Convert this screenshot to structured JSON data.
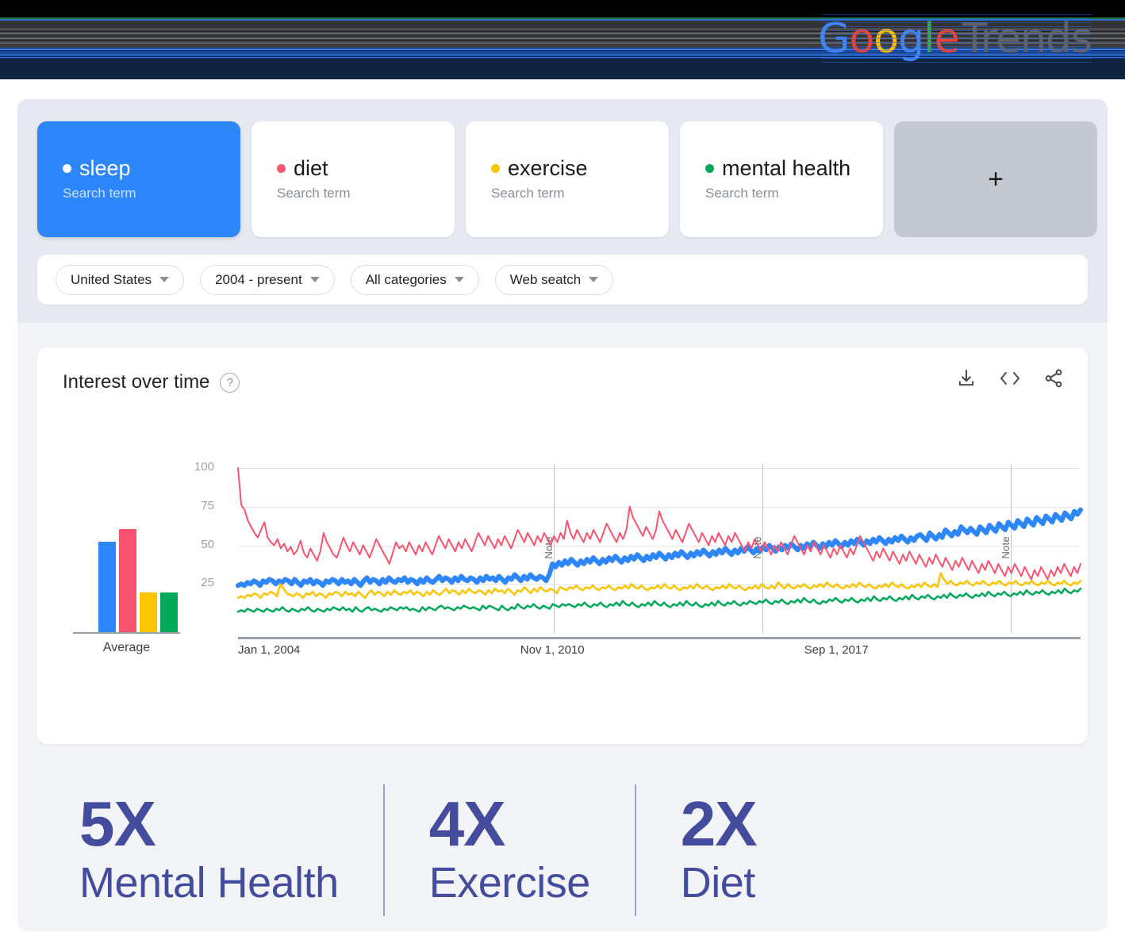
{
  "brand": {
    "logo_letters": [
      "G",
      "o",
      "o",
      "g",
      "l",
      "e"
    ],
    "logo_suffix": "Trends"
  },
  "search_terms": [
    {
      "term": "sleep",
      "type_label": "Search term",
      "color": "#ffffff",
      "active": true
    },
    {
      "term": "diet",
      "type_label": "Search term",
      "color": "#f9546f",
      "active": false
    },
    {
      "term": "exercise",
      "type_label": "Search term",
      "color": "#fdc500",
      "active": false
    },
    {
      "term": "mental health",
      "type_label": "Search term",
      "color": "#00a859",
      "active": false
    }
  ],
  "add_term_button": "+",
  "filters": [
    {
      "label": "United States"
    },
    {
      "label": "2004 - present"
    },
    {
      "label": "All categories"
    },
    {
      "label": "Web seatch"
    }
  ],
  "chart_card": {
    "title": "Interest over time",
    "help_icon": "?",
    "tools": [
      {
        "name": "download-icon"
      },
      {
        "name": "embed-code-icon"
      },
      {
        "name": "share-icon"
      }
    ]
  },
  "stats": [
    {
      "multiplier": "5X",
      "label": "Mental Health"
    },
    {
      "multiplier": "4X",
      "label": "Exercise"
    },
    {
      "multiplier": "2X",
      "label": "Diet"
    }
  ],
  "chart_data": {
    "type": "line",
    "title": "Interest over time",
    "xlabel": "",
    "ylabel": "",
    "ylim": [
      0,
      100
    ],
    "yticks": [
      100,
      75,
      50,
      25
    ],
    "xticks": [
      "Jan 1, 2004",
      "Nov 1, 2010",
      "Sep 1, 2017"
    ],
    "grid": true,
    "legend_position": "top-chips",
    "annotations": [
      {
        "text": "Note",
        "x_fraction": 0.375
      },
      {
        "text": "Note",
        "x_fraction": 0.622
      },
      {
        "text": "Note",
        "x_fraction": 0.917
      }
    ],
    "average_bar_chart": {
      "type": "bar",
      "label": "Average",
      "categories": [
        "sleep",
        "diet",
        "exercise",
        "mental health"
      ],
      "values": [
        43,
        49,
        19,
        19
      ],
      "colors": [
        "#2e86fb",
        "#f9546f",
        "#fdc500",
        "#00a859"
      ]
    },
    "series": [
      {
        "name": "sleep",
        "color": "#2e86fb",
        "width": 6,
        "values": [
          24,
          25,
          24,
          26,
          25,
          27,
          26,
          24,
          27,
          26,
          28,
          27,
          25,
          27,
          26,
          28,
          27,
          25,
          28,
          26,
          24,
          27,
          26,
          28,
          25,
          27,
          26,
          24,
          27,
          26,
          28,
          27,
          25,
          28,
          26,
          27,
          25,
          28,
          26,
          24,
          27,
          29,
          26,
          28,
          27,
          25,
          28,
          26,
          29,
          27,
          26,
          28,
          27,
          29,
          26,
          28,
          27,
          25,
          28,
          26,
          29,
          27,
          26,
          28,
          30,
          27,
          29,
          28,
          26,
          29,
          27,
          30,
          28,
          27,
          29,
          28,
          26,
          29,
          27,
          30,
          28,
          29,
          27,
          30,
          28,
          26,
          29,
          28,
          31,
          29,
          27,
          30,
          28,
          31,
          29,
          28,
          30,
          29,
          27,
          31,
          38,
          36,
          39,
          37,
          40,
          38,
          41,
          39,
          37,
          40,
          38,
          41,
          39,
          42,
          40,
          38,
          41,
          39,
          42,
          40,
          43,
          41,
          39,
          42,
          40,
          43,
          41,
          44,
          42,
          40,
          43,
          41,
          44,
          42,
          45,
          43,
          41,
          44,
          42,
          45,
          43,
          46,
          44,
          42,
          45,
          43,
          46,
          44,
          47,
          45,
          43,
          46,
          44,
          47,
          45,
          48,
          46,
          44,
          47,
          45,
          48,
          46,
          49,
          47,
          45,
          48,
          46,
          49,
          47,
          50,
          48,
          46,
          49,
          47,
          50,
          48,
          51,
          49,
          47,
          50,
          48,
          51,
          49,
          52,
          50,
          48,
          51,
          49,
          52,
          50,
          53,
          51,
          49,
          52,
          50,
          53,
          51,
          54,
          52,
          50,
          53,
          51,
          54,
          52,
          55,
          53,
          51,
          54,
          52,
          55,
          53,
          56,
          54,
          52,
          55,
          53,
          56,
          57,
          55,
          53,
          58,
          56,
          54,
          57,
          55,
          60,
          58,
          56,
          59,
          57,
          62,
          60,
          58,
          61,
          59,
          57,
          62,
          60,
          58,
          63,
          61,
          59,
          64,
          62,
          60,
          65,
          63,
          61,
          66,
          64,
          62,
          67,
          65,
          63,
          68,
          66,
          64,
          69,
          67,
          65,
          70,
          68,
          66,
          71,
          69,
          67,
          72,
          70,
          73
        ]
      },
      {
        "name": "diet",
        "color": "#f9546f",
        "width": 2,
        "values": [
          100,
          76,
          73,
          66,
          62,
          58,
          55,
          60,
          65,
          55,
          52,
          50,
          54,
          48,
          51,
          46,
          49,
          44,
          47,
          53,
          45,
          42,
          48,
          44,
          40,
          46,
          58,
          52,
          48,
          44,
          42,
          48,
          55,
          50,
          46,
          52,
          48,
          44,
          50,
          46,
          42,
          48,
          54,
          50,
          46,
          42,
          38,
          45,
          52,
          48,
          50,
          46,
          52,
          48,
          44,
          50,
          46,
          52,
          48,
          44,
          50,
          56,
          52,
          48,
          54,
          50,
          46,
          52,
          48,
          54,
          50,
          46,
          52,
          58,
          54,
          50,
          56,
          52,
          48,
          54,
          50,
          56,
          52,
          48,
          54,
          60,
          56,
          52,
          58,
          54,
          50,
          56,
          52,
          58,
          54,
          50,
          56,
          52,
          58,
          54,
          66,
          58,
          54,
          60,
          56,
          52,
          58,
          54,
          60,
          56,
          52,
          58,
          64,
          60,
          56,
          52,
          58,
          54,
          60,
          75,
          68,
          64,
          60,
          56,
          62,
          58,
          54,
          60,
          72,
          66,
          62,
          58,
          54,
          60,
          56,
          52,
          58,
          64,
          60,
          56,
          52,
          58,
          54,
          50,
          56,
          52,
          58,
          54,
          50,
          56,
          52,
          58,
          54,
          50,
          46,
          52,
          48,
          54,
          50,
          46,
          52,
          48,
          44,
          50,
          46,
          52,
          48,
          44,
          50,
          56,
          52,
          48,
          44,
          50,
          46,
          52,
          48,
          44,
          50,
          46,
          42,
          48,
          44,
          50,
          46,
          42,
          48,
          44,
          50,
          56,
          52,
          48,
          44,
          40,
          46,
          42,
          48,
          44,
          40,
          46,
          42,
          38,
          44,
          40,
          46,
          42,
          38,
          44,
          40,
          36,
          42,
          38,
          44,
          40,
          36,
          42,
          38,
          34,
          40,
          36,
          42,
          38,
          34,
          40,
          36,
          32,
          38,
          34,
          40,
          36,
          32,
          38,
          34,
          30,
          36,
          32,
          38,
          34,
          30,
          36,
          32,
          28,
          34,
          30,
          36,
          32,
          28,
          34,
          30,
          36,
          32,
          38,
          34,
          30,
          36,
          32,
          38
        ]
      },
      {
        "name": "exercise",
        "color": "#fdc500",
        "width": 2.5,
        "values": [
          16,
          17,
          16,
          18,
          17,
          19,
          18,
          16,
          19,
          18,
          20,
          19,
          17,
          25,
          22,
          19,
          18,
          17,
          19,
          18,
          16,
          19,
          18,
          20,
          17,
          19,
          18,
          16,
          19,
          18,
          20,
          19,
          17,
          20,
          18,
          19,
          17,
          20,
          18,
          16,
          19,
          21,
          18,
          20,
          19,
          17,
          20,
          18,
          21,
          19,
          18,
          20,
          19,
          21,
          18,
          20,
          19,
          17,
          20,
          18,
          21,
          19,
          18,
          20,
          22,
          19,
          21,
          20,
          18,
          21,
          19,
          22,
          20,
          19,
          21,
          20,
          18,
          21,
          19,
          22,
          20,
          21,
          19,
          22,
          20,
          18,
          21,
          20,
          23,
          21,
          19,
          22,
          20,
          23,
          21,
          20,
          22,
          21,
          19,
          23,
          22,
          21,
          23,
          22,
          24,
          22,
          21,
          23,
          22,
          24,
          22,
          21,
          23,
          22,
          24,
          22,
          21,
          23,
          22,
          24,
          22,
          25,
          23,
          22,
          24,
          22,
          21,
          23,
          22,
          24,
          22,
          25,
          23,
          22,
          24,
          22,
          21,
          23,
          22,
          24,
          22,
          25,
          23,
          22,
          24,
          22,
          21,
          23,
          22,
          24,
          22,
          25,
          23,
          22,
          24,
          22,
          21,
          23,
          22,
          24,
          22,
          25,
          23,
          22,
          24,
          22,
          26,
          24,
          22,
          25,
          23,
          22,
          24,
          23,
          25,
          23,
          22,
          24,
          23,
          25,
          23,
          26,
          24,
          23,
          25,
          23,
          22,
          24,
          23,
          25,
          23,
          26,
          24,
          23,
          25,
          23,
          22,
          24,
          23,
          25,
          23,
          26,
          24,
          23,
          25,
          23,
          22,
          24,
          23,
          25,
          23,
          26,
          24,
          23,
          25,
          23,
          32,
          28,
          25,
          27,
          25,
          24,
          26,
          25,
          27,
          25,
          24,
          26,
          25,
          27,
          25,
          24,
          26,
          25,
          27,
          25,
          24,
          26,
          25,
          27,
          25,
          24,
          26,
          25,
          27,
          25,
          24,
          26,
          25,
          27,
          25,
          24,
          26,
          25,
          27,
          25,
          24,
          26,
          25,
          27
        ]
      },
      {
        "name": "mental health",
        "color": "#00a859",
        "width": 2.5,
        "values": [
          7,
          8,
          7,
          9,
          8,
          7,
          9,
          8,
          7,
          9,
          8,
          7,
          9,
          8,
          10,
          8,
          7,
          9,
          8,
          7,
          9,
          8,
          10,
          8,
          7,
          9,
          8,
          7,
          9,
          8,
          10,
          9,
          8,
          10,
          8,
          9,
          7,
          10,
          8,
          7,
          9,
          10,
          8,
          9,
          8,
          7,
          9,
          8,
          10,
          9,
          8,
          10,
          9,
          10,
          8,
          9,
          8,
          7,
          10,
          8,
          10,
          9,
          8,
          10,
          11,
          9,
          10,
          9,
          8,
          10,
          9,
          11,
          10,
          9,
          10,
          9,
          8,
          11,
          9,
          11,
          10,
          9,
          8,
          11,
          9,
          8,
          10,
          9,
          12,
          10,
          9,
          11,
          10,
          12,
          10,
          9,
          11,
          10,
          9,
          12,
          11,
          10,
          12,
          11,
          12,
          11,
          10,
          12,
          11,
          13,
          11,
          10,
          12,
          11,
          13,
          11,
          10,
          12,
          11,
          13,
          11,
          14,
          12,
          11,
          13,
          11,
          10,
          12,
          11,
          13,
          11,
          14,
          12,
          11,
          13,
          11,
          10,
          12,
          11,
          13,
          11,
          14,
          12,
          11,
          13,
          11,
          10,
          12,
          11,
          13,
          11,
          14,
          12,
          11,
          13,
          12,
          14,
          12,
          11,
          13,
          12,
          14,
          13,
          12,
          14,
          13,
          15,
          13,
          12,
          14,
          13,
          15,
          13,
          12,
          14,
          13,
          15,
          13,
          16,
          14,
          13,
          15,
          13,
          12,
          14,
          13,
          15,
          14,
          16,
          14,
          13,
          15,
          14,
          16,
          14,
          13,
          15,
          14,
          16,
          14,
          17,
          15,
          14,
          16,
          15,
          17,
          15,
          14,
          16,
          15,
          17,
          15,
          18,
          16,
          15,
          17,
          16,
          18,
          16,
          15,
          17,
          16,
          18,
          16,
          19,
          17,
          16,
          18,
          17,
          19,
          17,
          16,
          18,
          17,
          19,
          17,
          20,
          18,
          17,
          19,
          18,
          20,
          18,
          17,
          19,
          18,
          20,
          18,
          21,
          19,
          18,
          20,
          19,
          21,
          19,
          18,
          20,
          19,
          21,
          19,
          22,
          20,
          19,
          21,
          20,
          22
        ]
      }
    ]
  }
}
